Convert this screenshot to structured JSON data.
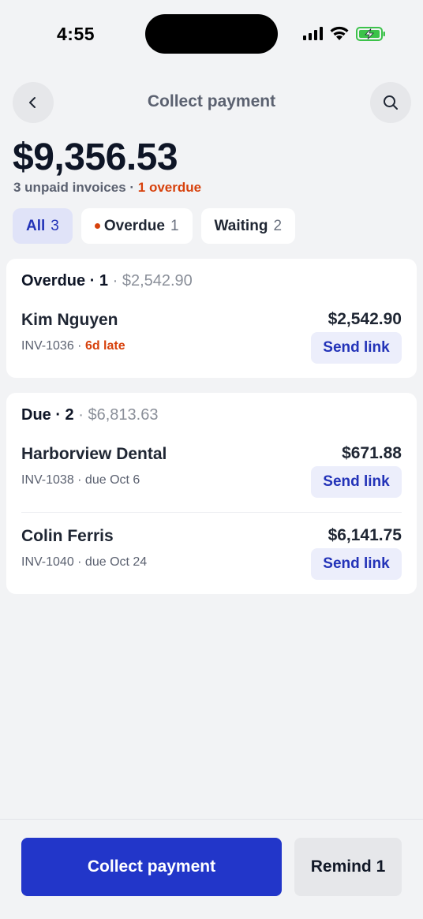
{
  "status_bar": {
    "time": "4:55"
  },
  "header": {
    "title": "Collect payment",
    "back_icon": "chevron-left-icon",
    "search_icon": "search-icon"
  },
  "summary": {
    "total": "$9,356.53",
    "unpaid_text": "3 unpaid invoices",
    "separator": " · ",
    "overdue_text": "1 overdue"
  },
  "filters": [
    {
      "label": "All",
      "count": "3",
      "active": true
    },
    {
      "label": "Overdue",
      "count": "1",
      "active": false,
      "dot_color": "#d7410c"
    },
    {
      "label": "Waiting",
      "count": "2",
      "active": false
    }
  ],
  "sections": {
    "overdue": {
      "title": "Overdue · 1",
      "subtotal": " · $2,542.90",
      "invoices": [
        {
          "customer": "Kim Nguyen",
          "invoice": "INV-1036",
          "separator": " · ",
          "status": "6d late",
          "amount": "$2,542.90",
          "action": "Send link"
        }
      ]
    },
    "due": {
      "title": "Due · 2",
      "subtotal": " · $6,813.63",
      "invoices": [
        {
          "customer": "Harborview Dental",
          "detail": "INV-1038 · due Oct 6",
          "amount": "$671.88",
          "action": "Send link"
        },
        {
          "customer": "Colin Ferris",
          "detail": "INV-1040 · due Oct 24",
          "amount": "$6,141.75",
          "action": "Send link"
        }
      ]
    }
  },
  "footer": {
    "primary": "Collect payment",
    "secondary": "Remind 1"
  },
  "colors": {
    "accent": "#2236c9",
    "overdue": "#d7410c",
    "background": "#f2f3f5"
  }
}
